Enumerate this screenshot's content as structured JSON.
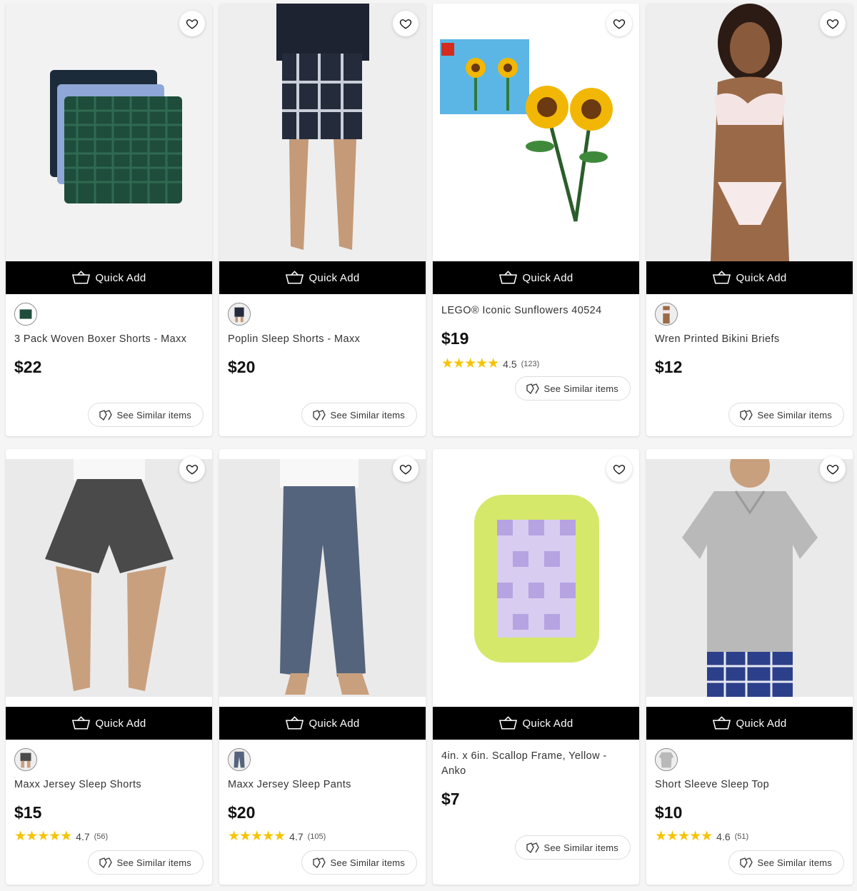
{
  "quick_add_label": "Quick Add",
  "see_similar_label": "See Similar items",
  "products": [
    {
      "name": "3 Pack Woven Boxer Shorts - Maxx",
      "price": "$22",
      "rating": null,
      "reviews": null,
      "stars": 0
    },
    {
      "name": "Poplin Sleep Shorts - Maxx",
      "price": "$20",
      "rating": null,
      "reviews": null,
      "stars": 0
    },
    {
      "name": "LEGO® Iconic Sunflowers 40524",
      "price": "$19",
      "rating": "4.5",
      "reviews": "(123)",
      "stars": 4.5
    },
    {
      "name": "Wren Printed Bikini Briefs",
      "price": "$12",
      "rating": null,
      "reviews": null,
      "stars": 0
    },
    {
      "name": "Maxx Jersey Sleep Shorts",
      "price": "$15",
      "rating": "4.7",
      "reviews": "(56)",
      "stars": 4.7
    },
    {
      "name": "Maxx Jersey Sleep Pants",
      "price": "$20",
      "rating": "4.7",
      "reviews": "(105)",
      "stars": 4.7
    },
    {
      "name": "4in. x 6in. Scallop Frame, Yellow - Anko",
      "price": "$7",
      "rating": null,
      "reviews": null,
      "stars": 0
    },
    {
      "name": "Short Sleeve Sleep Top",
      "price": "$10",
      "rating": "4.6",
      "reviews": "(51)",
      "stars": 4.6
    }
  ],
  "colors": {
    "quick_add_bg": "#000000",
    "star": "#f5c400",
    "card_bg": "#ffffff"
  }
}
